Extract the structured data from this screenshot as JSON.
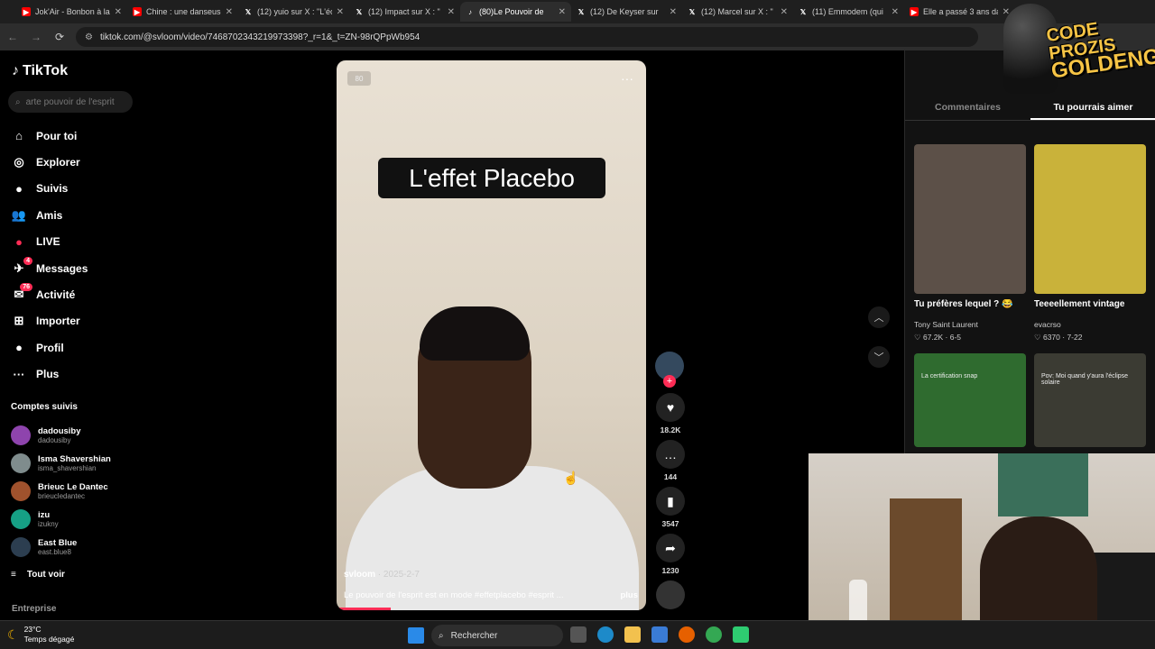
{
  "browser": {
    "tabs": [
      {
        "title": "Jok'Air - Bonbon à la",
        "icon": "youtube-icon",
        "color": "#ff0000"
      },
      {
        "title": "Chine : une danseuse",
        "icon": "youtube-icon",
        "color": "#ff0000"
      },
      {
        "title": "(12) yuio sur X : \"L'éc",
        "icon": "x-icon",
        "color": "#ffffff"
      },
      {
        "title": "(12) Impact sur X : \"",
        "icon": "x-icon",
        "color": "#ffffff"
      },
      {
        "title": "(80)Le Pouvoir de",
        "icon": "tiktok-icon",
        "color": "#ffffff",
        "active": true
      },
      {
        "title": "(12) De Keyser sur",
        "icon": "x-icon",
        "color": "#ffffff"
      },
      {
        "title": "(12) Marcel sur X : \"",
        "icon": "x-icon",
        "color": "#ffffff"
      },
      {
        "title": "(11) Emmodem (qui",
        "icon": "x-icon",
        "color": "#ffffff"
      },
      {
        "title": "Elle a passé 3 ans da",
        "icon": "youtube-icon",
        "color": "#ff0000"
      }
    ],
    "url": "tiktok.com/@svloom/video/7468702343219973398?_r=1&_t=ZN-98rQPpWb954"
  },
  "sidebar": {
    "logo": "TikTok",
    "search_placeholder": "arte pouvoir de l'esprit",
    "items": [
      {
        "label": "Pour toi",
        "icon": "home-icon"
      },
      {
        "label": "Explorer",
        "icon": "compass-icon"
      },
      {
        "label": "Suivis",
        "icon": "following-icon"
      },
      {
        "label": "Amis",
        "icon": "friends-icon"
      },
      {
        "label": "LIVE",
        "icon": "live-icon"
      },
      {
        "label": "Messages",
        "icon": "messages-icon",
        "badge": "4"
      },
      {
        "label": "Activité",
        "icon": "activity-icon",
        "badge": "76"
      },
      {
        "label": "Importer",
        "icon": "upload-icon"
      },
      {
        "label": "Profil",
        "icon": "profile-icon"
      },
      {
        "label": "Plus",
        "icon": "more-icon"
      }
    ],
    "follows_title": "Comptes suivis",
    "follows": [
      {
        "name": "dadousiby",
        "handle": "dadousiby"
      },
      {
        "name": "Isma Shavershian",
        "handle": "isma_shavershian"
      },
      {
        "name": "Brieuc Le Dantec",
        "handle": "brieucledantec"
      },
      {
        "name": "izu",
        "handle": "izukny"
      },
      {
        "name": "East Blue",
        "handle": "east.blue8"
      }
    ],
    "see_all": "Tout voir",
    "footer": "Entreprise"
  },
  "video": {
    "overlay_text": "L'effet Placebo",
    "mute_label": "80",
    "author": "svloom",
    "date": "· 2025-2-7",
    "caption": "Le pouvoir de l'esprit est en mode #effetplacebo #esprit ...",
    "more_label": "plus"
  },
  "actions": {
    "likes": "18.2K",
    "comments": "144",
    "saves": "3547",
    "shares": "1230"
  },
  "right_panel": {
    "tabs": [
      "Commentaires",
      "Tu pourrais aimer"
    ],
    "active_tab": 1,
    "cards": [
      {
        "title": "Tu préfères lequel ? 😂",
        "user": "Tony Saint Laurent",
        "stats": "♡ 67.2K · 6-5",
        "thumb_color": "#5c5048"
      },
      {
        "title": "Teeeellement vintage",
        "user": "evacrso",
        "stats": "♡ 6370 · 7-22",
        "thumb_color": "#c9b23a"
      },
      {
        "title": "",
        "user": "",
        "stats": "",
        "thumb_color": "#2f6b2f",
        "caption": "La certification snap"
      },
      {
        "title": "",
        "user": "",
        "stats": "",
        "thumb_color": "#3b3b33",
        "caption": "Pov: Moi quand y'aura l'éclipse solaire"
      }
    ]
  },
  "watermark": {
    "line1": "CODE PROZIS",
    "line2": "GOLDENG"
  },
  "taskbar": {
    "temp": "23°C",
    "weather": "Temps dégagé",
    "search": "Rechercher"
  }
}
